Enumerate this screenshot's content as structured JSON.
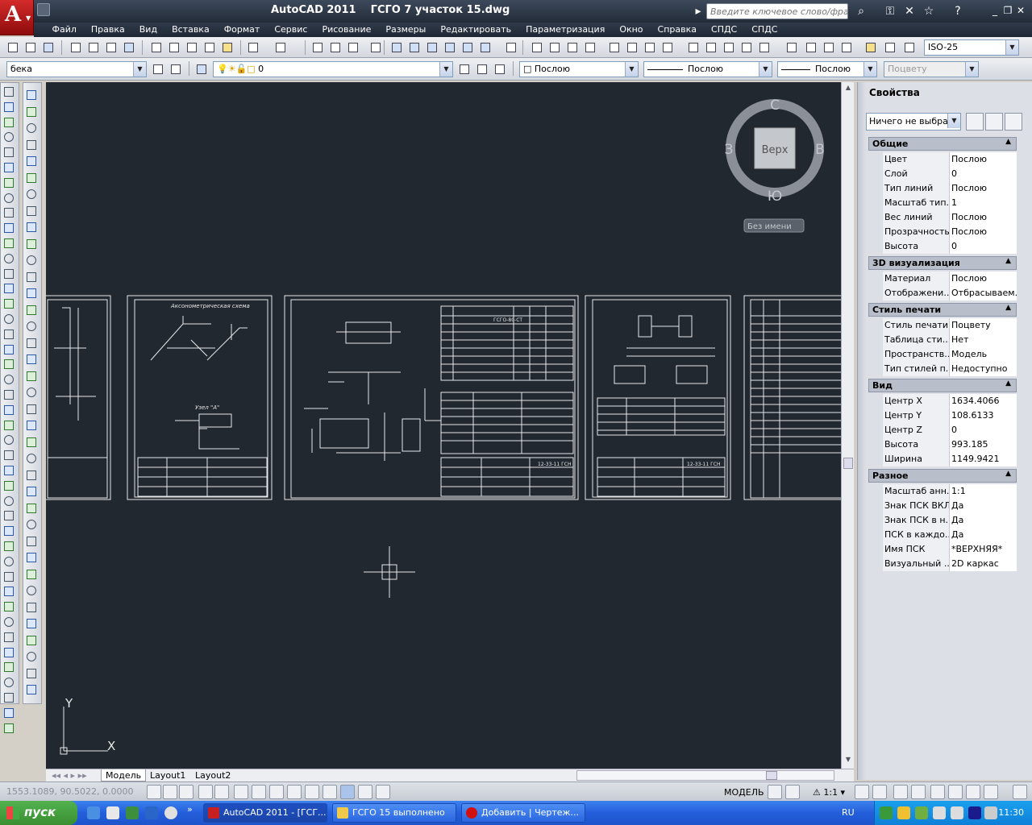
{
  "window": {
    "title": "AutoCAD 2011    ГСГО 7 участок 15.dwg",
    "search_placeholder": "Введите ключевое слово/фразу"
  },
  "menu": [
    "Файл",
    "Правка",
    "Вид",
    "Вставка",
    "Формат",
    "Сервис",
    "Рисование",
    "Размеры",
    "Редактировать",
    "Параметризация",
    "Окно",
    "Справка",
    "СПДС",
    "СПДС"
  ],
  "toolbar": {
    "dimstyle": "ISO-25",
    "workspace": "бека",
    "layer": "0",
    "color": "Послою",
    "linetype": "Послою",
    "lineweight": "Послою",
    "plotstyle": "Поцвету"
  },
  "viewcube": {
    "face": "Верх",
    "north": "С",
    "south": "Ю",
    "east": "В",
    "west": "З",
    "ucs": "Без имени"
  },
  "ucs_icon": {
    "x": "X",
    "y": "Y"
  },
  "drawing_sheets": {
    "sheet2_title": "Аксонометрическая схема",
    "sheet2_node": "Узел \"А\"",
    "sheet3_table_title": "ГСГО-80-СТ",
    "stamp_code": "12-33-11 ГСН",
    "sheet4_stamp": "12-33-11 ГСН"
  },
  "layout_tabs": [
    "Модель",
    "Layout1",
    "Layout2"
  ],
  "properties": {
    "title": "Свойства",
    "selection": "Ничего не выбрано",
    "categories": [
      {
        "name": "Общие",
        "rows": [
          [
            "Цвет",
            "Послою"
          ],
          [
            "Слой",
            "0"
          ],
          [
            "Тип линий",
            "Послою"
          ],
          [
            "Масштаб тип...",
            "1"
          ],
          [
            "Вес линий",
            "Послою"
          ],
          [
            "Прозрачность",
            "Послою"
          ],
          [
            "Высота",
            "0"
          ]
        ]
      },
      {
        "name": "3D визуализация",
        "rows": [
          [
            "Материал",
            "Послою"
          ],
          [
            "Отображени...",
            "Отбрасываем..."
          ]
        ]
      },
      {
        "name": "Стиль печати",
        "rows": [
          [
            "Стиль печати",
            "Поцвету"
          ],
          [
            "Таблица сти...",
            "Нет"
          ],
          [
            "Пространств...",
            "Модель"
          ],
          [
            "Тип стилей п...",
            "Недоступно"
          ]
        ]
      },
      {
        "name": "Вид",
        "rows": [
          [
            "Центр X",
            "1634.4066"
          ],
          [
            "Центр Y",
            "108.6133"
          ],
          [
            "Центр Z",
            "0"
          ],
          [
            "Высота",
            "993.185"
          ],
          [
            "Ширина",
            "1149.9421"
          ]
        ]
      },
      {
        "name": "Разное",
        "rows": [
          [
            "Масштаб анн...",
            "1:1"
          ],
          [
            "Знак ПСК ВКЛ",
            "Да"
          ],
          [
            "Знак ПСК в н...",
            "Да"
          ],
          [
            "ПСК в каждо...",
            "Да"
          ],
          [
            "Имя ПСК",
            "*ВЕРХНЯЯ*"
          ],
          [
            "Визуальный ...",
            "2D каркас"
          ]
        ]
      }
    ]
  },
  "status": {
    "coords": "1553.1089, 90.5022, 0.0000",
    "space": "МОДЕЛЬ",
    "scale": "1:1"
  },
  "taskbar": {
    "start": "пуск",
    "items": [
      "AutoCAD 2011 - [ГСГ...",
      "ГСГО 15 выполнено",
      "Добавить | Чертеж..."
    ],
    "lang": "RU",
    "clock": "11:30"
  }
}
